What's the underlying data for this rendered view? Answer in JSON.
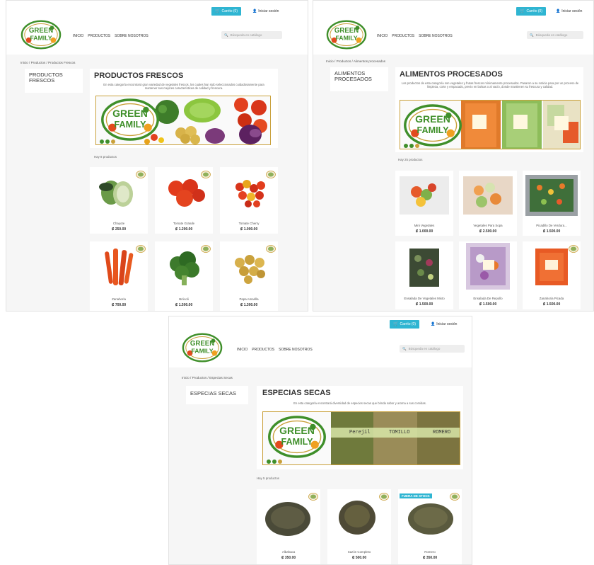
{
  "header": {
    "cart_label": "Carrito (0)",
    "login_label": "Iniciar sesión",
    "nav": [
      "INICIO",
      "PRODUCTOS",
      "SOBRE NOSOTROS"
    ],
    "search_placeholder": "Búsqueda en catálogo",
    "logo_text_1": "GREEN",
    "logo_text_2": "FAMILY"
  },
  "panels": [
    {
      "breadcrumb": [
        "Inicio",
        "Productos",
        "Productos Frescos"
      ],
      "sidebar": "PRODUCTOS FRESCOS",
      "title": "PRODUCTOS FRESCOS",
      "description": "En esta categoría encontrará gran variedad de vegetales frescos, los cuales han sido seleccionados cuidadosamente para mantener sus mejores características de calidad y frescura.",
      "count": "Hay 8 productos",
      "products": [
        {
          "name": "Chayote",
          "price": "₡ 250.00"
        },
        {
          "name": "Tomate Grande",
          "price": "₡ 1.200.00"
        },
        {
          "name": "Tomate Cherry",
          "price": "₡ 1.000.00"
        },
        {
          "name": "Zanahoria",
          "price": "₡ 700.00"
        },
        {
          "name": "Brócoli",
          "price": "₡ 1.500.00"
        },
        {
          "name": "Papa Amarilla",
          "price": "₡ 1.300.00"
        }
      ]
    },
    {
      "breadcrumb": [
        "Inicio",
        "Productos",
        "Alimentos procesados"
      ],
      "sidebar": "ALIMENTOS PROCESADOS",
      "title": "ALIMENTOS PROCESADOS",
      "description": "Los productos de esta categoría son vegetales y frutas frescos mínimamente procesados. Pasaron a su noticia para por un proceso de limpieza, corte y empacado, previo en bolsas o al vacío, donde mantienen su frescura y calidad.",
      "count": "Hay 25 productos",
      "products": [
        {
          "name": "Mini Vegetales",
          "price": "₡ 1.000.00"
        },
        {
          "name": "Vegetales Para Sopa",
          "price": "₡ 2.500.00"
        },
        {
          "name": "Picadillo De Verdura...",
          "price": "₡ 1.500.00"
        },
        {
          "name": "Ensalada De Vegetales Mixto",
          "price": "₡ 1.500.00"
        },
        {
          "name": "Ensalada De Repollo",
          "price": "₡ 1.500.00"
        },
        {
          "name": "Zanahoria Picada",
          "price": "₡ 1.500.00"
        }
      ]
    },
    {
      "breadcrumb": [
        "Inicio",
        "Productos",
        "Especias Secas"
      ],
      "sidebar": "ESPECIAS SECAS",
      "title": "ESPECIAS SECAS",
      "description": "En esta categoría encontrará diversidad de especies secas que brinda sabor y aroma a sus comidas.",
      "count": "Hay 5 productos",
      "banner_labels": [
        "Perejil",
        "TOMILLO",
        "ROMERO"
      ],
      "out_of_stock": "FUERA DE STOCK",
      "products": [
        {
          "name": "Albahaca",
          "price": "₡ 350.00"
        },
        {
          "name": "Sazón Completo",
          "price": "₡ 500.00"
        },
        {
          "name": "Romero",
          "price": "₡ 350.00"
        }
      ]
    }
  ],
  "colors": {
    "accent": "#2fb5d2",
    "brand_green": "#3f8f2a",
    "brand_gold": "#c9a03a"
  }
}
